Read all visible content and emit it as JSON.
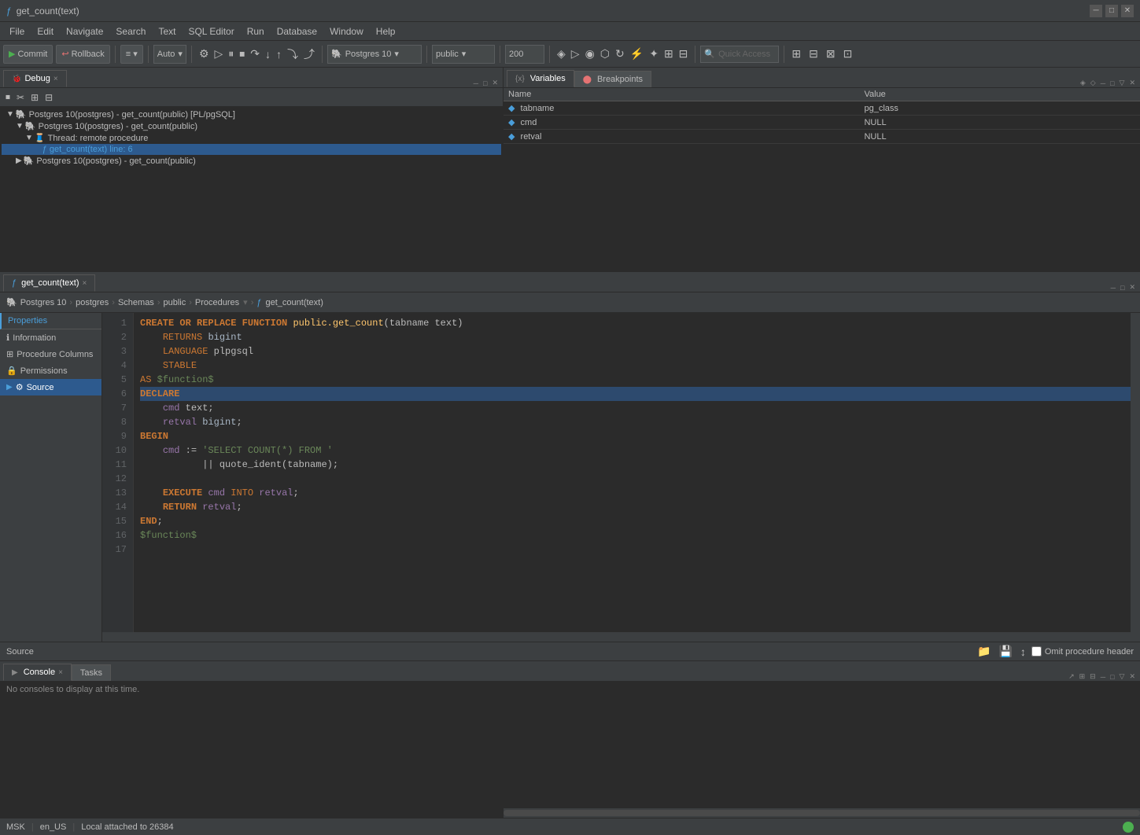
{
  "titlebar": {
    "title": "get_count(text)",
    "icon": "ƒ"
  },
  "menubar": {
    "items": [
      "File",
      "Edit",
      "Navigate",
      "Search",
      "Text",
      "SQL Editor",
      "Run",
      "Database",
      "Window",
      "Help"
    ]
  },
  "toolbar": {
    "commit_label": "Commit",
    "rollback_label": "Rollback",
    "auto_label": "Auto",
    "postgres_label": "Postgres 10",
    "public_label": "public",
    "zoom_value": "200",
    "quick_access_placeholder": "Quick Access"
  },
  "debug_tab": {
    "label": "Debug",
    "close": "×"
  },
  "debug_tree": {
    "items": [
      {
        "label": "Postgres 10(postgres) - get_count(public) [PL/pgSQL]",
        "indent": 0,
        "type": "db",
        "expanded": true
      },
      {
        "label": "Postgres 10(postgres) - get_count(public)",
        "indent": 1,
        "type": "db",
        "expanded": true
      },
      {
        "label": "Thread: remote procedure",
        "indent": 2,
        "type": "thread",
        "expanded": true
      },
      {
        "label": "get_count(text) line: 6",
        "indent": 3,
        "type": "func",
        "selected": true
      },
      {
        "label": "Postgres 10(postgres) - get_count(public)",
        "indent": 1,
        "type": "db",
        "expanded": false
      }
    ]
  },
  "variables_tab": {
    "label": "Variables"
  },
  "breakpoints_tab": {
    "label": "Breakpoints"
  },
  "variables": {
    "columns": [
      "Name",
      "Value"
    ],
    "rows": [
      {
        "name": "tabname",
        "value": "pg_class"
      },
      {
        "name": "cmd",
        "value": "NULL"
      },
      {
        "name": "retval",
        "value": "NULL"
      }
    ]
  },
  "editor_tab": {
    "label": "get_count(text)",
    "icon": "ƒ",
    "close": "×"
  },
  "breadcrumb": {
    "items": [
      "Postgres 10",
      "postgres",
      "Schemas",
      "public",
      "Procedures",
      "get_count(text)"
    ]
  },
  "properties": {
    "tabs": [
      {
        "label": "Properties"
      }
    ],
    "items": [
      {
        "label": "Information",
        "icon": "ℹ"
      },
      {
        "label": "Procedure Columns",
        "icon": "⊞"
      },
      {
        "label": "Permissions",
        "icon": "🔒"
      },
      {
        "label": "Source",
        "icon": "⚙",
        "active": true
      }
    ]
  },
  "code": {
    "lines": [
      {
        "num": 1,
        "text": "CREATE OR REPLACE FUNCTION public.get_count(tabname text)",
        "type": "normal"
      },
      {
        "num": 2,
        "text": "    RETURNS bigint",
        "type": "normal"
      },
      {
        "num": 3,
        "text": "    LANGUAGE plpgsql",
        "type": "normal"
      },
      {
        "num": 4,
        "text": "    STABLE",
        "type": "normal"
      },
      {
        "num": 5,
        "text": "AS $function$",
        "type": "normal"
      },
      {
        "num": 6,
        "text": "DECLARE",
        "type": "highlighted"
      },
      {
        "num": 7,
        "text": "    cmd text;",
        "type": "normal"
      },
      {
        "num": 8,
        "text": "    retval bigint;",
        "type": "normal"
      },
      {
        "num": 9,
        "text": "BEGIN",
        "type": "normal"
      },
      {
        "num": 10,
        "text": "    cmd := 'SELECT COUNT(*) FROM '",
        "type": "normal"
      },
      {
        "num": 11,
        "text": "           || quote_ident(tabname);",
        "type": "normal"
      },
      {
        "num": 12,
        "text": "",
        "type": "normal"
      },
      {
        "num": 13,
        "text": "    EXECUTE cmd INTO retval;",
        "type": "normal"
      },
      {
        "num": 14,
        "text": "    RETURN retval;",
        "type": "normal"
      },
      {
        "num": 15,
        "text": "END;",
        "type": "normal"
      },
      {
        "num": 16,
        "text": "$function$",
        "type": "normal"
      },
      {
        "num": 17,
        "text": "",
        "type": "normal"
      }
    ]
  },
  "source_bar": {
    "label": "Source",
    "omit_checkbox": "Omit procedure header"
  },
  "console": {
    "tab_label": "Console",
    "tab_close": "×",
    "tasks_label": "Tasks",
    "empty_msg": "No consoles to display at this time."
  },
  "statusbar": {
    "locale": "MSK",
    "language": "en_US",
    "connection": "Local attached to 26384"
  }
}
